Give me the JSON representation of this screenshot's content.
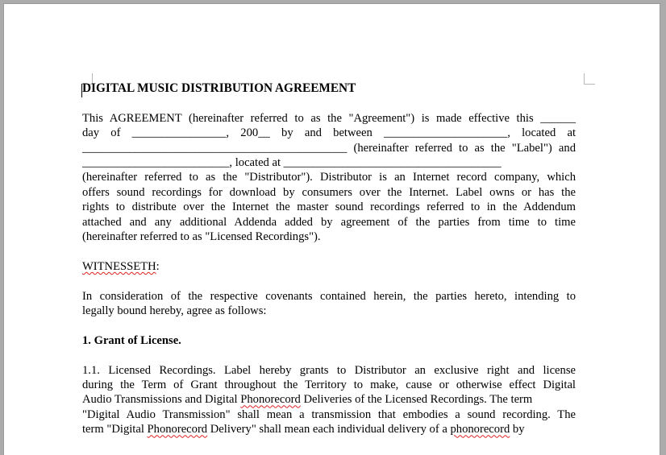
{
  "document": {
    "title": "DIGITAL MUSIC DISTRIBUTION AGREEMENT",
    "intro": {
      "l1": "This AGREEMENT (hereinafter referred to as the \"Agreement\") is made effective this ______",
      "l2": "day of ________________, 200__ by and between _____________________, located at",
      "l3": "_____________________________________________ (hereinafter referred to as the \"Label\") and",
      "l4": "_________________________, located at _____________________________________",
      "l5": "(hereinafter referred to as the \"Distributor\"). Distributor is an Internet record company, which",
      "l6": "offers sound recordings for download by consumers over the Internet. Label owns or has the",
      "l7": "rights to distribute over the Internet the master sound recordings referred to in the Addendum",
      "l8": "attached and any additional Addenda added by agreement of the parties from time to time",
      "l9": "(hereinafter referred to as \"Licensed Recordings\")."
    },
    "witnesseth": "WITNESSETH",
    "witnesseth_colon": ":",
    "consideration": {
      "l1": "In consideration of the respective covenants contained herein, the parties hereto, intending to",
      "l2": "legally bound hereby, agree as follows:"
    },
    "section1_heading": "1. Grant of License.",
    "section1_1": {
      "l1": "1.1. Licensed Recordings. Label hereby grants to Distributor an exclusive right and license",
      "l2": "during the Term of Grant throughout the Territory to make, cause or otherwise effect Digital",
      "l3a": "Audio Transmissions and Digital ",
      "l3b": "Phonorecord",
      "l3c": " Deliveries of the Licensed Recordings. The term",
      "l4": "\"Digital Audio Transmission\" shall mean a transmission that embodies a sound recording. The",
      "l5a": "term \"Digital ",
      "l5b": "Phonorecord",
      "l5c": " Delivery\" shall mean each individual delivery of a ",
      "l5d": "phonorecord",
      "l5e": " by"
    }
  }
}
